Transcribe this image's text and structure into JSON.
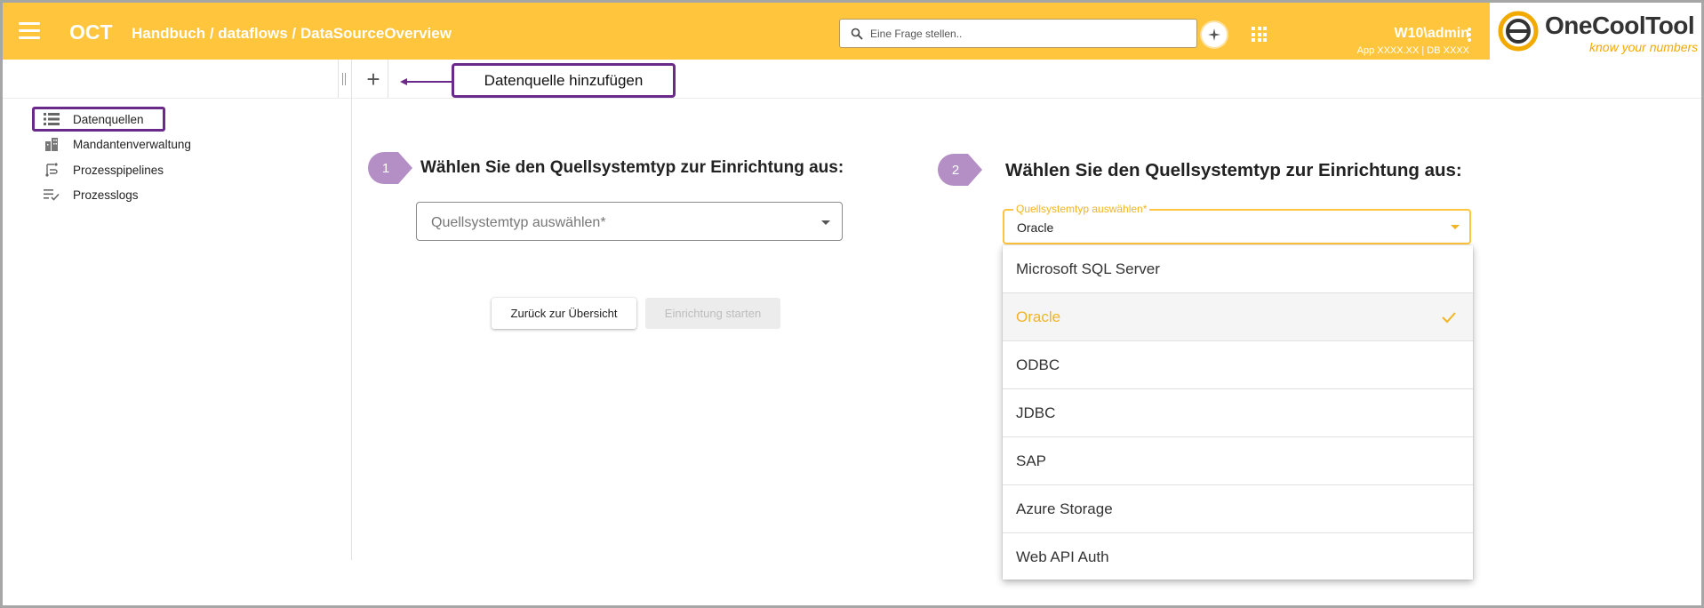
{
  "header": {
    "app_name": "OCT",
    "breadcrumb": "Handbuch / dataflows / DataSourceOverview",
    "search_placeholder": "Eine Frage stellen..",
    "user": "W10\\admin",
    "user_meta": "App XXXX.XX | DB XXXX",
    "logo_name": "OneCoolTool",
    "logo_tagline": "know your numbers"
  },
  "toolbar": {
    "add_label": "+",
    "annotation": "Datenquelle hinzufügen"
  },
  "sidebar": {
    "items": [
      {
        "label": "Datenquellen",
        "icon": "list-icon"
      },
      {
        "label": "Mandantenverwaltung",
        "icon": "buildings-icon"
      },
      {
        "label": "Prozesspipelines",
        "icon": "pipeline-icon"
      },
      {
        "label": "Prozesslogs",
        "icon": "log-check-icon"
      }
    ]
  },
  "step1": {
    "badge": "1",
    "title": "Wählen Sie den Quellsystemtyp zur Einrichtung aus:",
    "select_placeholder": "Quellsystemtyp auswählen*",
    "back_button": "Zurück zur Übersicht",
    "start_button": "Einrichtung starten"
  },
  "step2": {
    "badge": "2",
    "title": "Wählen Sie den Quellsystemtyp zur Einrichtung aus:",
    "select_label": "Quellsystemtyp auswählen*",
    "select_value": "Oracle",
    "options": [
      {
        "label": "Microsoft SQL Server",
        "selected": false
      },
      {
        "label": "Oracle",
        "selected": true
      },
      {
        "label": "ODBC",
        "selected": false
      },
      {
        "label": "JDBC",
        "selected": false
      },
      {
        "label": "SAP",
        "selected": false
      },
      {
        "label": "Azure Storage",
        "selected": false
      },
      {
        "label": "Web API Auth",
        "selected": false
      }
    ]
  },
  "colors": {
    "brand": "#fec53d",
    "annotation": "#6a2a8c",
    "badge": "#b48fc5",
    "selected_text": "#f2b422"
  }
}
